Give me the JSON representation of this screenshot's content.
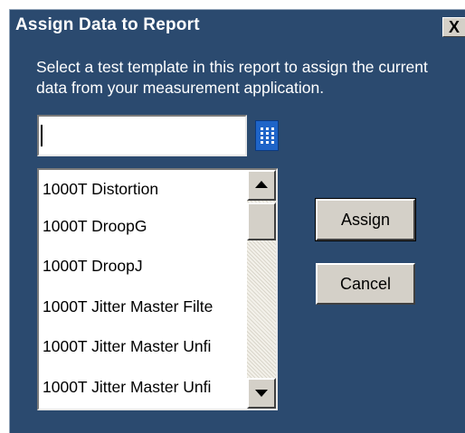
{
  "dialog": {
    "title": "Assign Data to Report",
    "close_label": "X",
    "instructions": "Select a test template in this report to assign the current data from your measurement application."
  },
  "search": {
    "value": "",
    "placeholder": ""
  },
  "template_list": {
    "items": [
      "1000T Distortion",
      "1000T DroopG",
      "1000T DroopJ",
      "1000T Jitter Master Filte",
      "1000T Jitter Master Unfi",
      "1000T Jitter Master Unfi"
    ]
  },
  "buttons": {
    "assign_label": "Assign",
    "cancel_label": "Cancel"
  },
  "icons": {
    "keypad": "keypad-icon",
    "scroll_up": "arrow-up-icon",
    "scroll_down": "arrow-down-icon"
  },
  "colors": {
    "window_background": "#2b4a6f",
    "keypad_button": "#1e64c8"
  }
}
